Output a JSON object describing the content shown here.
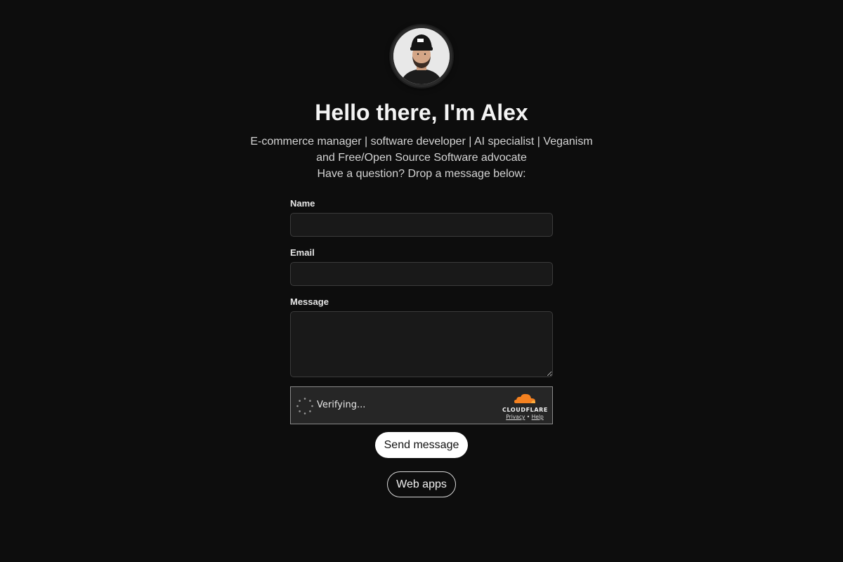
{
  "profile": {
    "avatar_alt": "Alex profile photo",
    "heading": "Hello there, I'm Alex",
    "bio_line1": "E-commerce manager | software developer | AI specialist | Veganism and Free/Open Source Software advocate",
    "bio_line2": "Have a question? Drop a message below:"
  },
  "form": {
    "name_label": "Name",
    "name_value": "",
    "email_label": "Email",
    "email_value": "",
    "message_label": "Message",
    "message_value": ""
  },
  "captcha": {
    "status": "Verifying...",
    "brand": "CLOUDFLARE",
    "privacy_link": "Privacy",
    "separator": "•",
    "help_link": "Help",
    "brand_color": "#f48120"
  },
  "buttons": {
    "send": "Send message",
    "web_apps": "Web apps"
  },
  "colors": {
    "background": "#0d0d0d",
    "input_background": "#191919",
    "primary_button": "#ffffff"
  }
}
